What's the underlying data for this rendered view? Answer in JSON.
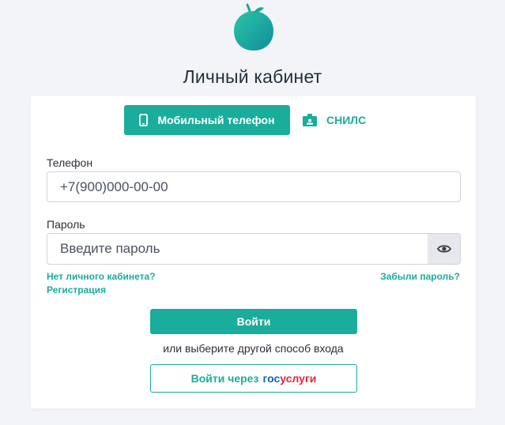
{
  "colors": {
    "accent": "#1aad9b",
    "background": "#f3f4f8",
    "gos_blue": "#0b65b7",
    "gos_red": "#e6263a"
  },
  "header": {
    "logo_icon": "leaf-drop-logo",
    "title": "Личный кабинет"
  },
  "tabs": [
    {
      "label": "Мобильный телефон",
      "icon": "phone-icon",
      "active": true
    },
    {
      "label": "СНИЛС",
      "icon": "id-card-icon",
      "active": false
    }
  ],
  "phone_field": {
    "label": "Телефон",
    "value": "+7(900)000-00-00"
  },
  "password_field": {
    "label": "Пароль",
    "placeholder": "Введите пароль",
    "toggle_icon": "eye-icon"
  },
  "links": {
    "no_account": "Нет личного кабинета?",
    "register": "Регистрация",
    "forgot": "Забыли пароль?"
  },
  "actions": {
    "login_label": "Войти",
    "alt_text": "или выберите другой способ входа",
    "gosuslugi_prefix": "Войти через",
    "gosuslugi_brand_part1": "гос",
    "gosuslugi_brand_part2": "услуги"
  }
}
